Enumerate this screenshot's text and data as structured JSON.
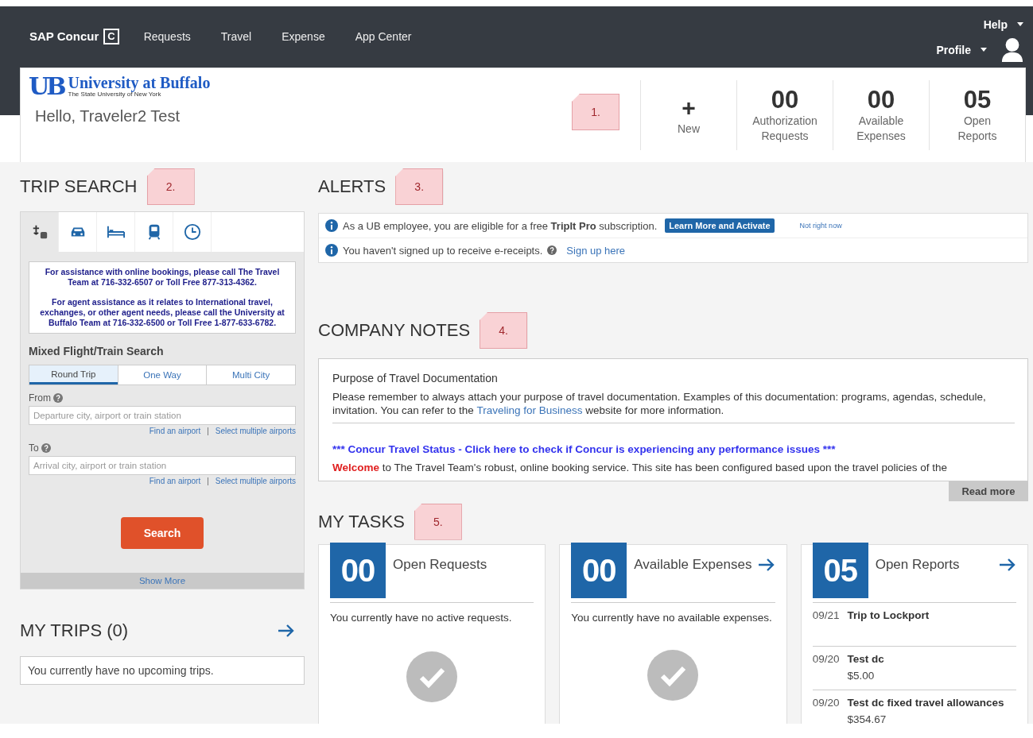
{
  "nav": {
    "brand": "SAP Concur",
    "brand_mark": "C",
    "items": [
      "Requests",
      "Travel",
      "Expense",
      "App Center"
    ],
    "help": "Help",
    "profile": "Profile"
  },
  "header": {
    "logo_mark": "UB",
    "org_name": "University at Buffalo",
    "org_sub": "The State University of New York",
    "greeting": "Hello, Traveler2 Test",
    "note": "1.",
    "stats": [
      {
        "kind": "action",
        "value": "+",
        "label": "New"
      },
      {
        "kind": "count",
        "value": "00",
        "label": "Authorization Requests"
      },
      {
        "kind": "count",
        "value": "00",
        "label": "Available Expenses"
      },
      {
        "kind": "count",
        "value": "05",
        "label": "Open Reports"
      }
    ]
  },
  "trip_search": {
    "title": "TRIP SEARCH",
    "note": "2.",
    "tabs": [
      {
        "kind": "flight",
        "selected": true
      },
      {
        "kind": "car",
        "selected": false
      },
      {
        "kind": "hotel",
        "selected": false
      },
      {
        "kind": "rail",
        "selected": false
      },
      {
        "kind": "recent",
        "selected": false
      }
    ],
    "notice": [
      "For assistance with online bookings, please call The Travel Team at 716-332-6507 or Toll Free 877-313-4362.",
      "For agent assistance as it relates to International travel, exchanges, or other agent needs, please call the University at Buffalo Team at 716-332-6500 or Toll Free 1-877-633-6782."
    ],
    "form_title": "Mixed Flight/Train Search",
    "trip_types": [
      {
        "label": "Round Trip",
        "selected": true
      },
      {
        "label": "One Way",
        "selected": false
      },
      {
        "label": "Multi City",
        "selected": false
      }
    ],
    "fields": [
      {
        "label": "From",
        "help": true,
        "placeholder": "Departure city, airport or train station",
        "links": [
          "Find an airport",
          "Select multiple airports"
        ],
        "separator": "|"
      },
      {
        "label": "To",
        "help": true,
        "placeholder": "Arrival city, airport or train station",
        "links": [
          "Find an airport",
          "Select multiple airports"
        ],
        "separator": "|"
      }
    ],
    "search_button": "Search",
    "show_more": "Show More"
  },
  "my_trips": {
    "title": "MY TRIPS (0)",
    "arrow": true,
    "empty": "You currently have no upcoming trips."
  },
  "alerts": {
    "title": "ALERTS",
    "note": "3.",
    "items": [
      {
        "kind": "promo",
        "text": "As a UB employee, you are eligible for a free **TripIt Pro** subscription.",
        "action": "Learn More and Activate",
        "dismiss": "Not right now"
      },
      {
        "kind": "link",
        "text": "You haven't signed up to receive e-receipts.",
        "help": true,
        "link": "Sign up here"
      }
    ]
  },
  "company_notes": {
    "title": "COMPANY NOTES",
    "note": "4.",
    "heading": "Purpose of Travel Documentation",
    "body_before": "Please remember to always attach your purpose of travel documentation. Examples of this documentation: programs, agendas, schedule, invitation. You can refer to the ",
    "body_link": "Traveling for Business",
    "body_after": " website for more information.",
    "status_link": "*** Concur Travel Status - Click here to check if Concur is experiencing any performance issues ***",
    "welcome_word": "Welcome",
    "welcome_rest": " to The Travel Team's robust, online booking service. This site has been configured based upon the travel policies of the",
    "read_more": "Read more"
  },
  "tasks": {
    "title": "MY TASKS",
    "note": "5.",
    "cards": [
      {
        "kind": "empty",
        "count": "00",
        "title": "Open Requests",
        "arrow": false,
        "message": "You currently have no active requests."
      },
      {
        "kind": "empty",
        "count": "00",
        "title": "Available Expenses",
        "arrow": true,
        "message": "You currently have no available expenses."
      },
      {
        "kind": "list",
        "count": "05",
        "title": "Open Reports",
        "arrow": true,
        "items": [
          {
            "date": "09/21",
            "name": "Trip to Lockport"
          },
          {
            "date": "09/20",
            "name": "Test dc",
            "amount": "$5.00"
          },
          {
            "date": "09/20",
            "name": "Test dc fixed travel allowances",
            "amount": "$354.67"
          }
        ]
      }
    ]
  }
}
